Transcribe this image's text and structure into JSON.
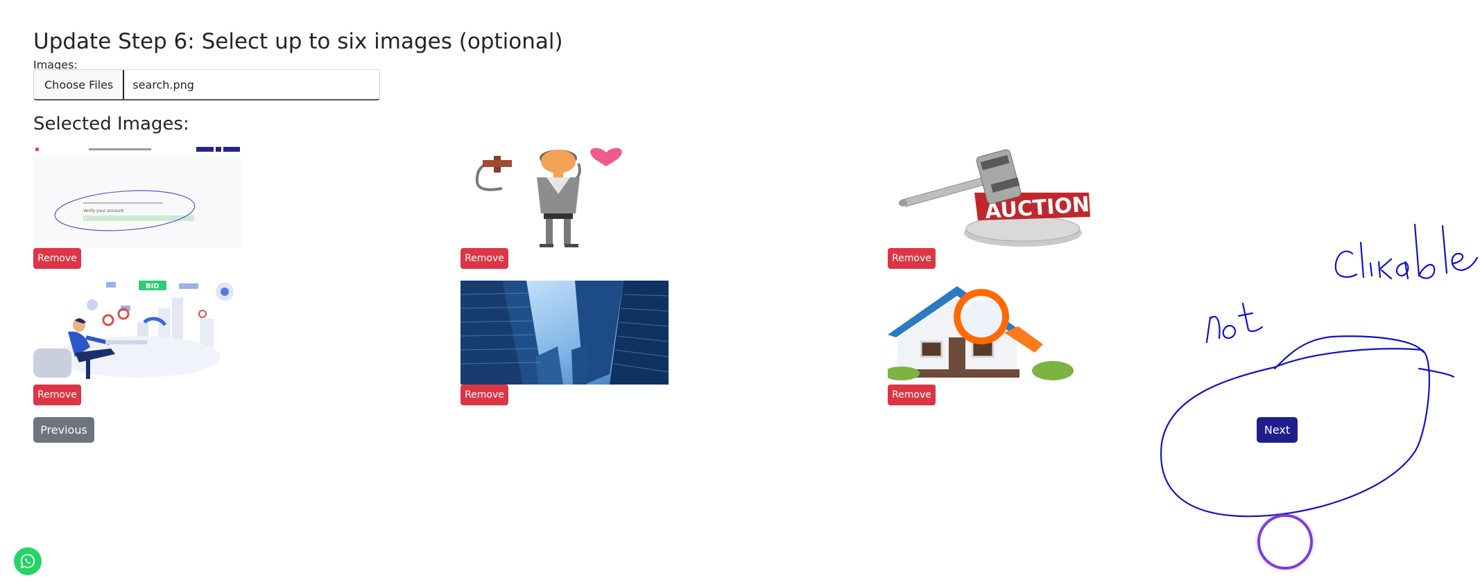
{
  "page": {
    "heading": "Update Step 6: Select up to six images (optional)",
    "images_label": "Images:",
    "file_input": {
      "button_label": "Choose Files",
      "file_name": "search.png"
    },
    "selected_heading": "Selected Images:"
  },
  "images": [
    {
      "name": "screenshot-thumbnail",
      "remove_label": "Remove"
    },
    {
      "name": "auctioneer-illustration",
      "remove_label": "Remove"
    },
    {
      "name": "auction-gavel",
      "remove_label": "Remove"
    },
    {
      "name": "bidding-analytics-illustration",
      "remove_label": "Remove"
    },
    {
      "name": "skyscrapers-photo",
      "remove_label": "Remove"
    },
    {
      "name": "house-search-illustration",
      "remove_label": "Remove"
    }
  ],
  "thumb_texts": {
    "screenshot_line": "Verify your account",
    "bid_badge": "BID",
    "auction_word": "AUCTION"
  },
  "nav": {
    "previous_label": "Previous",
    "next_label": "Next"
  },
  "annotation": {
    "handwritten_text": "Not Clickable",
    "ink_color": "#1010cc"
  },
  "colors": {
    "remove": "#dc3545",
    "previous": "#6c757d",
    "next": "#1e1f8a",
    "whatsapp": "#25d366",
    "cursor_ring": "#7e3bd6"
  },
  "icons": {
    "chat": "whatsapp-icon"
  }
}
